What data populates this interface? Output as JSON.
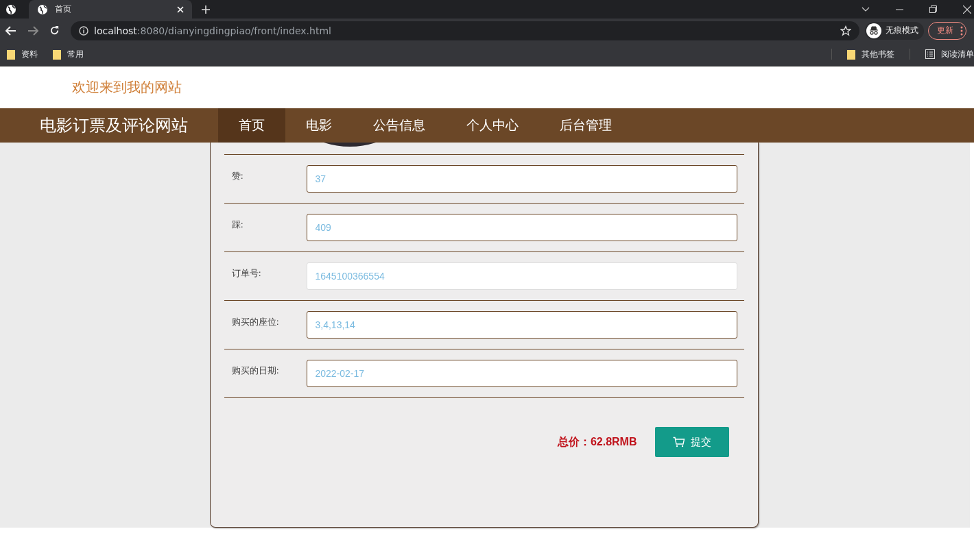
{
  "browser": {
    "tabs": [
      {
        "title": "首页",
        "selected": true
      }
    ],
    "address": {
      "host": "localhost",
      "path": ":8080/dianyingdingpiao/front/index.html"
    },
    "profile": "无痕模式",
    "update_button": "更新",
    "bookmarks": [
      "资料",
      "常用"
    ],
    "other_bookmarks": "其他书签",
    "reading_list": "阅读清单"
  },
  "header": {
    "welcome": "欢迎来到我的网站"
  },
  "nav": {
    "brand": "电影订票及评论网站",
    "items": [
      {
        "label": "首页",
        "selected": true
      },
      {
        "label": "电影",
        "selected": false
      },
      {
        "label": "公告信息",
        "selected": false
      },
      {
        "label": "个人中心",
        "selected": false
      },
      {
        "label": "后台管理",
        "selected": false
      }
    ]
  },
  "form": {
    "fields": [
      {
        "label": "赞:",
        "value": "37",
        "readonly": false
      },
      {
        "label": "踩:",
        "value": "409",
        "readonly": false
      },
      {
        "label": "订单号:",
        "value": "1645100366554",
        "readonly": true
      },
      {
        "label": "购买的座位:",
        "value": "3,4,13,14",
        "readonly": false
      },
      {
        "label": "购买的日期:",
        "value": "2022-02-17",
        "readonly": false
      }
    ],
    "total": "总价：62.8RMB",
    "submit": "提交"
  }
}
